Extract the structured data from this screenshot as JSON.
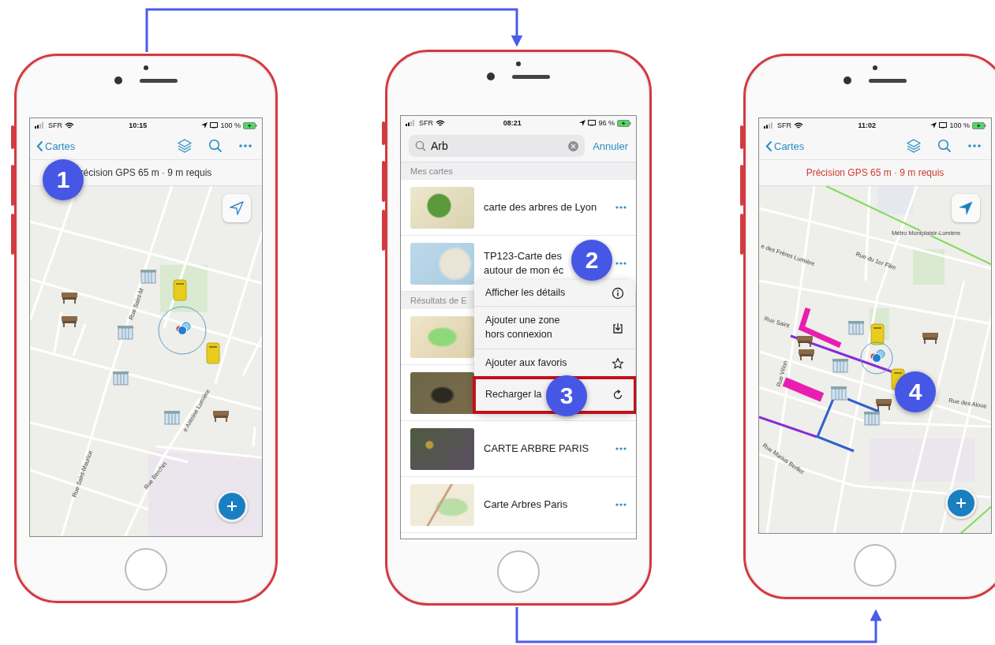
{
  "phones": [
    {
      "kind": "map",
      "status_bar": {
        "carrier": "SFR",
        "time": "10:15",
        "battery": "100 %"
      },
      "nav": {
        "back": "Cartes"
      },
      "gps_banner": {
        "text": "récision GPS 65 m · 9 m requis",
        "alert": false
      },
      "map": {
        "location_active": false,
        "labels": [
          "Rue Saint-Maurice",
          "Rue Berchet",
          "Rue Saint-M",
          "e Antoine Lumière"
        ]
      }
    },
    {
      "kind": "search",
      "status_bar": {
        "carrier": "SFR",
        "time": "08:21",
        "battery": "96 %"
      },
      "search": {
        "value": "Arb",
        "cancel": "Annuler"
      },
      "sections": [
        {
          "title": "Mes cartes",
          "items": [
            {
              "kind": "titled",
              "title": "carte des arbres de Lyon",
              "more_button": true
            },
            {
              "kind": "titled",
              "title": "TP123-Carte des\nautour de mon éc",
              "more_button": true
            }
          ]
        },
        {
          "title": "Résultats de E",
          "items": [
            {
              "kind": "covered"
            },
            {
              "kind": "covered"
            },
            {
              "kind": "titled",
              "title": "CARTE ARBRE PARIS",
              "more_button": true
            },
            {
              "kind": "titled",
              "title": "Carte Arbres Paris",
              "more_button": true
            }
          ]
        }
      ],
      "menu": [
        {
          "label": "Afficher les détails",
          "highlighted": false
        },
        {
          "label": "Ajouter une zone\nhors connexion",
          "highlighted": false
        },
        {
          "label": "Ajouter aux favoris",
          "highlighted": false
        },
        {
          "label": "Recharger la",
          "highlighted": true
        }
      ]
    },
    {
      "kind": "map",
      "status_bar": {
        "carrier": "SFR",
        "time": "11:02",
        "battery": "100 %"
      },
      "nav": {
        "back": "Cartes"
      },
      "gps_banner": {
        "text": "Précision GPS 65 m · 9 m requis",
        "alert": true
      },
      "map": {
        "location_active": true,
        "labels": [
          "e des Frères Lumière",
          "Rue du 1er Film",
          "Métro Montplaisir-Lumière",
          "Rue Villon",
          "Rue Marius Berliet",
          "Rue des Aloue",
          "Rue Saint"
        ]
      }
    }
  ],
  "step_badges": [
    "1",
    "2",
    "3",
    "4"
  ]
}
